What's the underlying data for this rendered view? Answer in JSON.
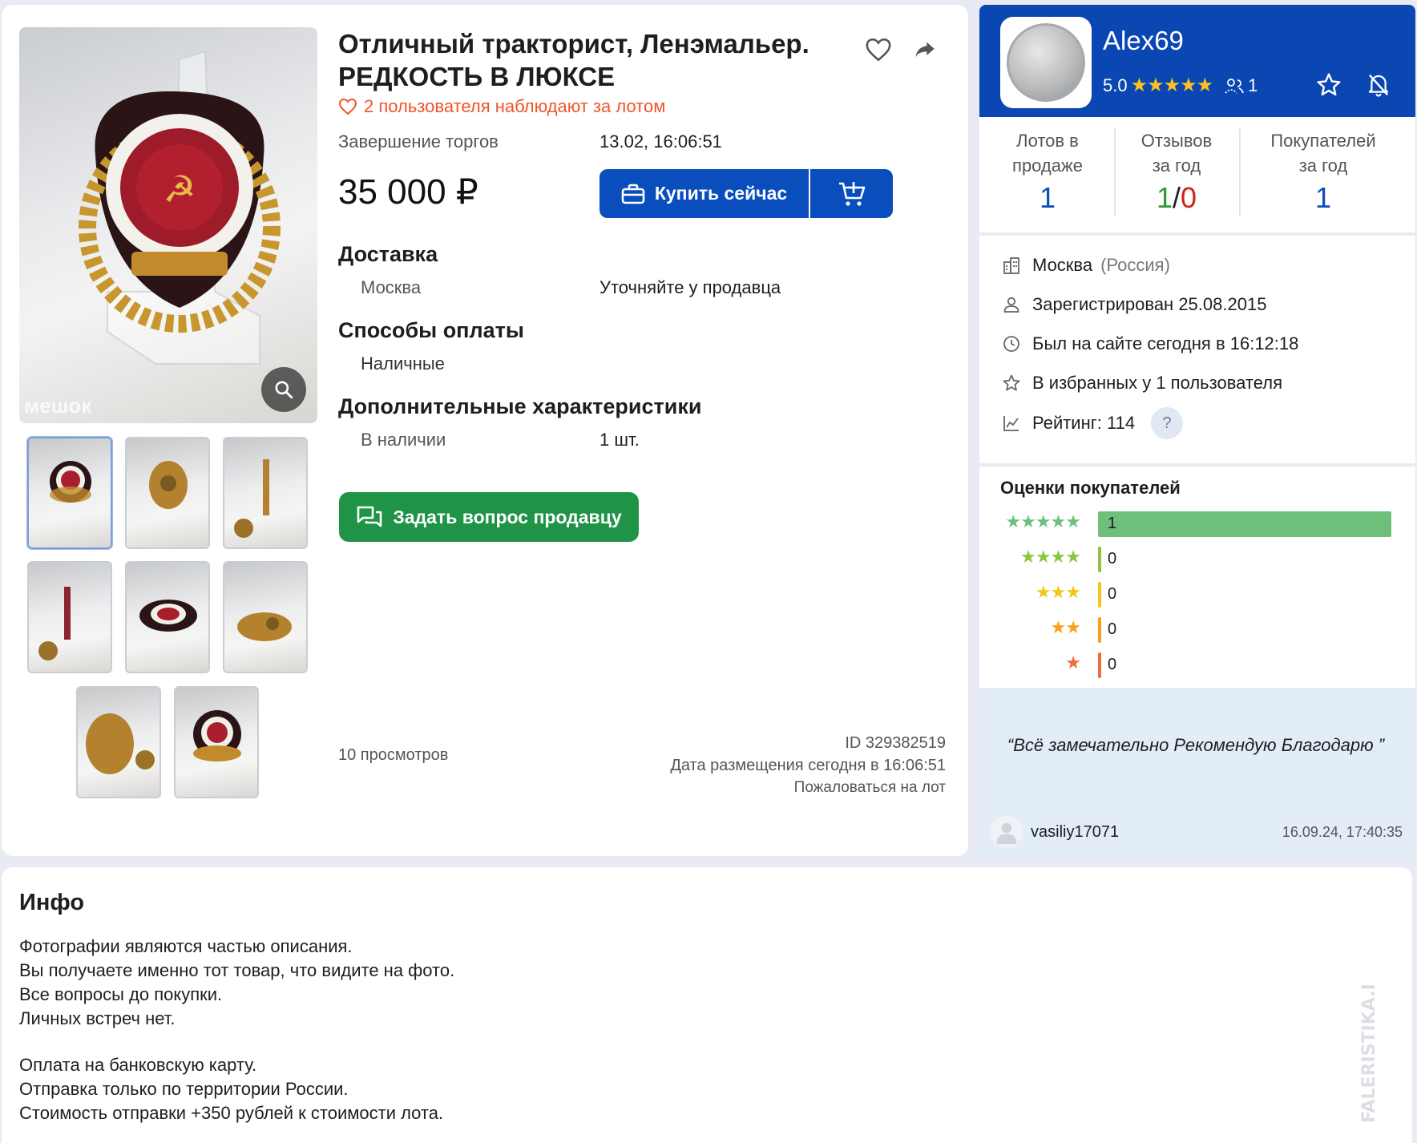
{
  "lot": {
    "title": "Отличный тракторист, Ленэмальер. РЕДКОСТЬ В ЛЮКСЕ",
    "watchers": "2 пользователя наблюдают за лотом",
    "end_label": "Завершение торгов",
    "end_value": "13.02, 16:06:51",
    "price": "35 000 ₽",
    "buy_label": "Купить сейчас",
    "delivery_title": "Доставка",
    "delivery_city": "Москва",
    "delivery_value": "Уточняйте у продавца",
    "payment_title": "Способы оплаты",
    "payment_value": "Наличные",
    "extra_title": "Дополнительные характеристики",
    "availability_label": "В наличии",
    "availability_value": "1 шт.",
    "ask_label": "Задать вопрос продавцу",
    "views": "10 просмотров",
    "id": "ID 329382519",
    "posted": "Дата размещения сегодня в 16:06:51",
    "report": "Пожаловаться на лот",
    "photo_watermark": "мешок"
  },
  "seller": {
    "name": "Alex69",
    "rating": "5.0",
    "rating_stars": "★★★★★",
    "followers": "1",
    "stats": [
      {
        "label_1": "Лотов в",
        "label_2": "продаже",
        "value": "1"
      },
      {
        "label_1": "Отзывов",
        "label_2": "за год",
        "value_pos": "1",
        "value_sep": "/",
        "value_neg": "0"
      },
      {
        "label_1": "Покупателей",
        "label_2": "за год",
        "value": "1"
      }
    ],
    "city": "Москва",
    "country": "(Россия)",
    "registered": "Зарегистрирован 25.08.2015",
    "last_seen": "Был на сайте сегодня в 16:12:18",
    "favorites": "В избранных у 1 пользователя",
    "rating_text": "Рейтинг: 114",
    "help": "?"
  },
  "ratings": {
    "title": "Оценки покупателей",
    "rows": [
      {
        "stars": "★★★★★",
        "value": "1",
        "color": "#6dbf7a"
      },
      {
        "stars": "★★★★",
        "value": "0",
        "color": "#8cc63f"
      },
      {
        "stars": "★★★",
        "value": "0",
        "color": "#f5c518"
      },
      {
        "stars": "★★",
        "value": "0",
        "color": "#f7a11a"
      },
      {
        "stars": "★",
        "value": "0",
        "color": "#f26b3a"
      }
    ]
  },
  "review": {
    "text": "“Всё замечательно Рекомендую Благодарю ”",
    "author": "vasiliy17071",
    "date": "16.09.24, 17:40:35"
  },
  "info": {
    "title": "Инфо",
    "lines_1": [
      "Фотографии являются частью описания.",
      "Вы получаете именно тот товар, что видите на фото.",
      "Все вопросы до покупки.",
      "Личных встреч нет."
    ],
    "lines_2": [
      "Оплата на банковскую карту.",
      "Отправка только по территории России.",
      "Стоимость отправки +350 рублей к стоимости лота."
    ]
  },
  "colors": {
    "primary": "#0a4dbd",
    "green": "#1f9346",
    "watch": "#f0542a",
    "negative": "#d0201a",
    "positive": "#2e9a3a"
  }
}
